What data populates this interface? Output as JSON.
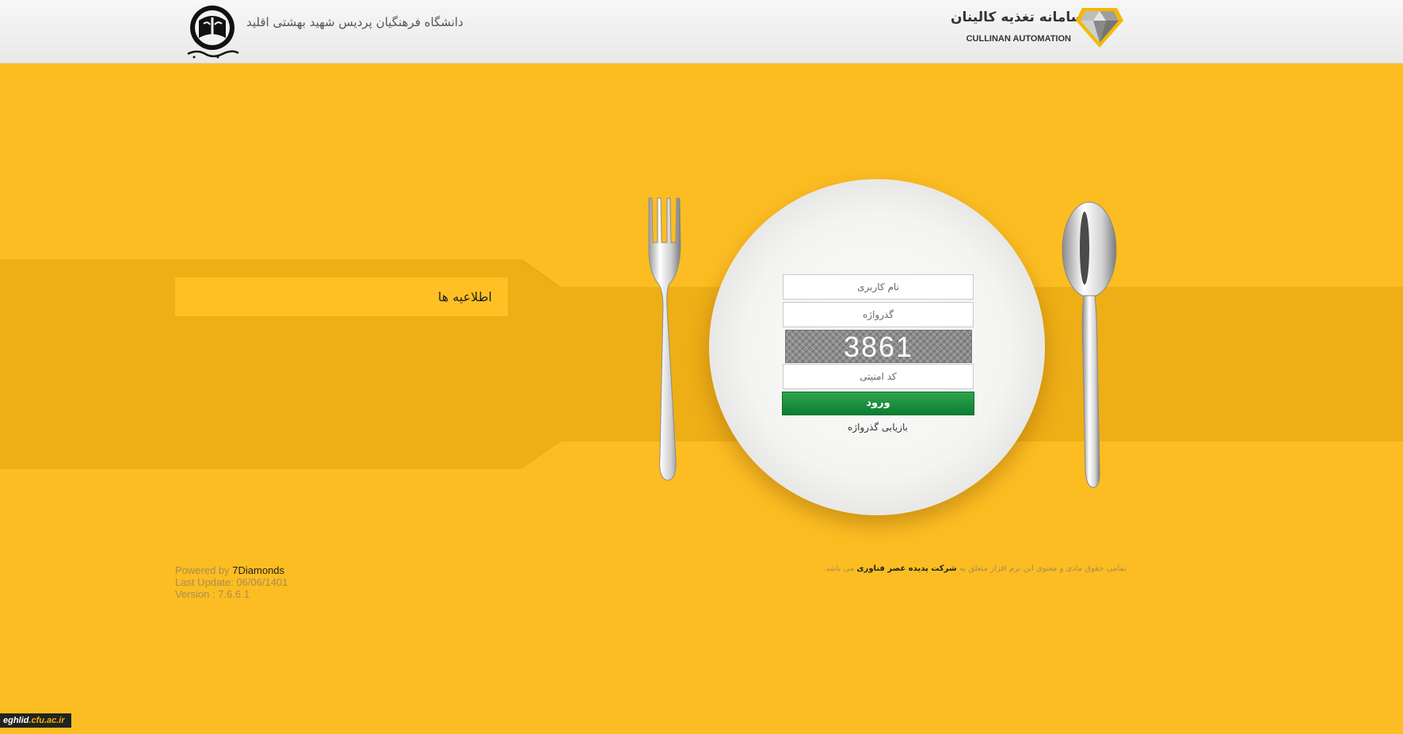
{
  "header": {
    "university_name": "دانشگاه فرهنگیان پردیس شهید بهشتی اقلید",
    "system_title": "سامانه تغذیه کالینان",
    "system_subtitle": "CULLINAN AUTOMATION",
    "university_logo_icon": "university-emblem-icon",
    "brand_logo_icon": "diamond-icon"
  },
  "news": {
    "title": "اطلاعیه ها"
  },
  "login": {
    "username_placeholder": "نام کاربری",
    "password_placeholder": "گذرواژه",
    "captcha_code": "3861",
    "captcha_placeholder": "کد امنیتی",
    "submit_label": "ورود",
    "recover_label": "بازیابی گذرواژه"
  },
  "footer": {
    "powered_by_prefix": "Powered by",
    "powered_by_brand": "7Diamonds",
    "last_update": "Last Update: 06/06/1401",
    "version": "Version : 7.6.6.1",
    "rights_prefix": "تمامی حقوق مادی و معنوی این نرم افزار متعلق به",
    "rights_company": "شرکت پدیده عصر فناوری",
    "rights_suffix": "می باشد.",
    "watermark_prefix": "eghlid",
    "watermark_domain": ".cfu.ac.ir"
  },
  "colors": {
    "background": "#fcbd22",
    "band": "#eeae16",
    "login_button": "#0b7d33"
  }
}
